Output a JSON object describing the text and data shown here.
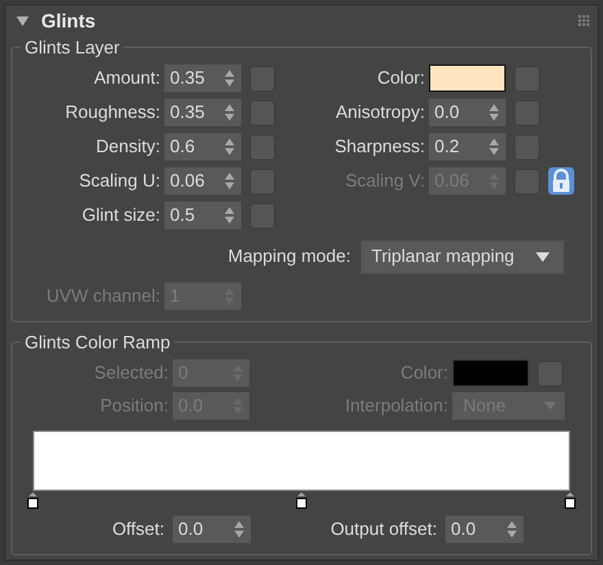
{
  "rollout": {
    "title": "Glints",
    "expanded": true
  },
  "glints_layer": {
    "title": "Glints Layer",
    "rows": [
      {
        "cells": [
          {
            "kind": "spinner",
            "label": "Amount:",
            "value": "0.35",
            "disabled": false,
            "map_button": true
          },
          {
            "kind": "color",
            "label": "Color:",
            "color": "#ffe4c0",
            "disabled": false,
            "map_button": true
          }
        ]
      },
      {
        "cells": [
          {
            "kind": "spinner",
            "label": "Roughness:",
            "value": "0.35",
            "disabled": false,
            "map_button": true
          },
          {
            "kind": "spinner",
            "label": "Anisotropy:",
            "value": "0.0",
            "disabled": false,
            "map_button": true
          }
        ]
      },
      {
        "cells": [
          {
            "kind": "spinner",
            "label": "Density:",
            "value": "0.6",
            "disabled": false,
            "map_button": true
          },
          {
            "kind": "spinner",
            "label": "Sharpness:",
            "value": "0.2",
            "disabled": false,
            "map_button": true
          }
        ]
      },
      {
        "cells": [
          {
            "kind": "spinner",
            "label": "Scaling U:",
            "value": "0.06",
            "disabled": false,
            "map_button": true
          },
          {
            "kind": "spinner",
            "label": "Scaling V:",
            "value": "0.06",
            "disabled": true,
            "map_button": true,
            "locked": true
          }
        ]
      },
      {
        "cells": [
          {
            "kind": "spinner",
            "label": "Glint size:",
            "value": "0.5",
            "disabled": false,
            "map_button": true
          }
        ]
      }
    ],
    "mapping_mode": {
      "label": "Mapping mode:",
      "value": "Triplanar mapping",
      "disabled": false
    },
    "uvw_channel": {
      "label": "UVW channel:",
      "value": "1",
      "disabled": true
    }
  },
  "color_ramp": {
    "title": "Glints Color Ramp",
    "rows": [
      {
        "cells": [
          {
            "kind": "spinner",
            "label": "Selected:",
            "value": "0",
            "disabled": true
          },
          {
            "kind": "color",
            "label": "Color:",
            "color": "#000000",
            "disabled": true,
            "map_button": true
          }
        ]
      },
      {
        "cells": [
          {
            "kind": "spinner",
            "label": "Position:",
            "value": "0.0",
            "disabled": true
          },
          {
            "kind": "dropdown",
            "label": "Interpolation:",
            "value": "None",
            "disabled": true
          }
        ]
      }
    ],
    "stops": [
      {
        "level": 0
      },
      {
        "level": 0.5
      },
      {
        "level": 1
      }
    ],
    "offset": {
      "label": "Offset:",
      "value": "0.0",
      "disabled": false
    },
    "output_offset": {
      "label": "Output offset:",
      "value": "0.0",
      "disabled": false
    }
  }
}
